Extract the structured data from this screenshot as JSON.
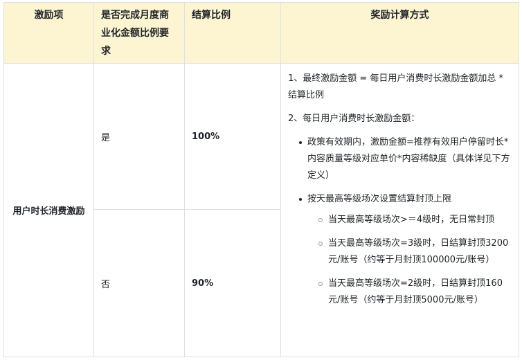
{
  "table": {
    "headers": {
      "item": "激励项",
      "done_line1": "是否完成月度商",
      "done_line2": "业化金额比例要",
      "done_line3": "求",
      "ratio": "结算比例",
      "calc": "奖励计算方式"
    },
    "item_name": "用户时长消费激励",
    "rows": [
      {
        "done": "是",
        "ratio": "100%"
      },
      {
        "done": "否",
        "ratio": "90%"
      }
    ],
    "calc": {
      "para1": "1、最终激励金额 = 每日用户消费时长激励金额加总 * 结算比例",
      "para2": "2、每日用户消费时长激励金额：",
      "bullet1": "政策有效期内，激励金额=推荐有效用户停留时长*内容质量等级对应单价*内容稀缺度（具体详见下方定义）",
      "bullet2": "按天最高等级场次设置结算封顶上限",
      "sub1": "当天最高等级场次>＝4级时，无日常封顶",
      "sub2": "当天最高等级场次=3级时，日结算封顶3200元/账号（约等于月封顶100000元/账号）",
      "sub3": "当天最高等级场次=2级时，日结算封顶160元/账号（约等于月封顶5000元/账号）"
    }
  }
}
